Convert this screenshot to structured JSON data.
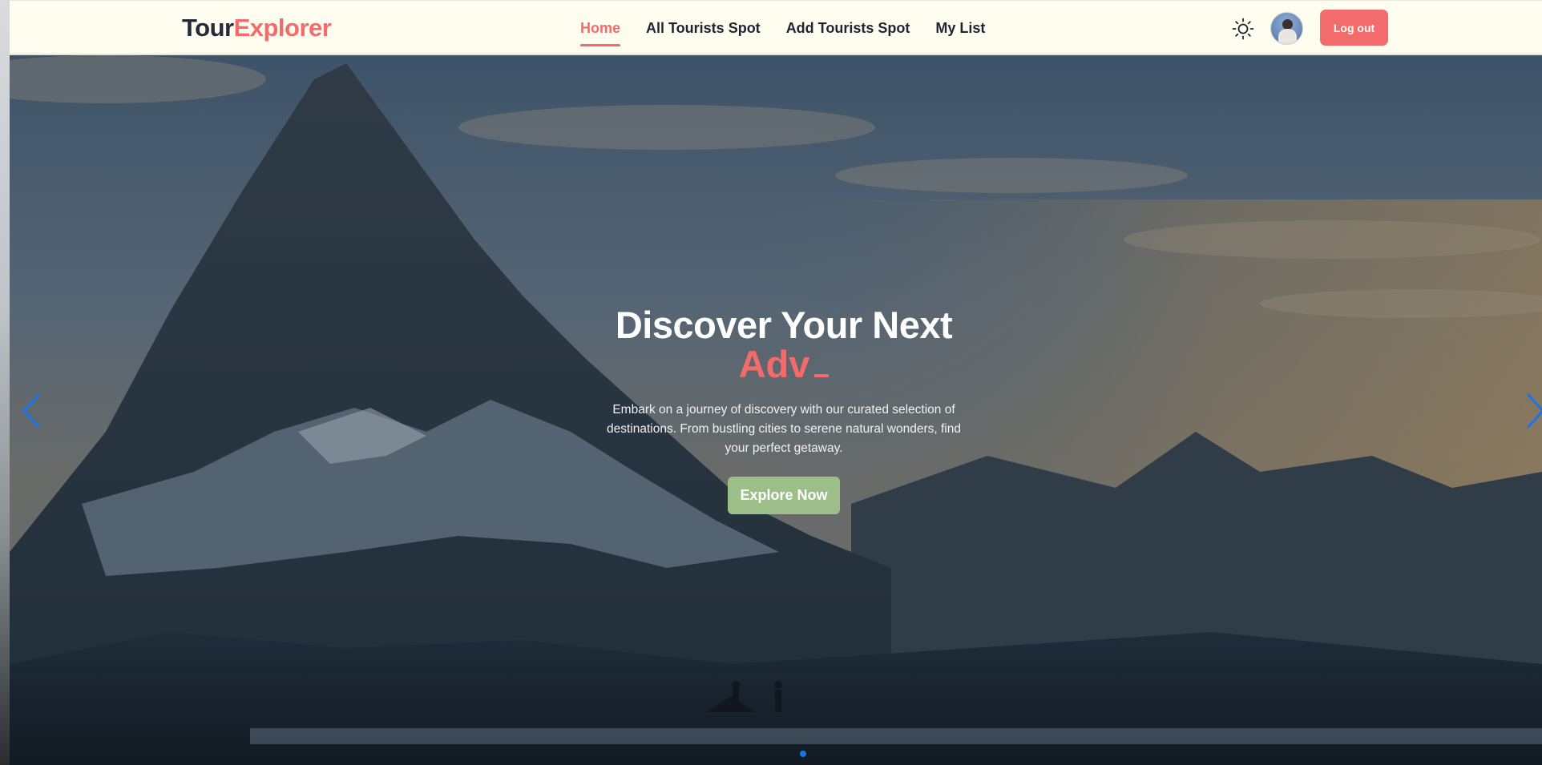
{
  "brand": {
    "part1": "Tour",
    "part2": "Explorer"
  },
  "nav": {
    "items": [
      {
        "label": "Home",
        "active": true
      },
      {
        "label": "All Tourists Spot",
        "active": false
      },
      {
        "label": "Add Tourists Spot",
        "active": false
      },
      {
        "label": "My List",
        "active": false
      }
    ],
    "theme_icon": "sun-icon",
    "logout_label": "Log out"
  },
  "hero": {
    "title": "Discover Your Next",
    "typed_text": "Adv",
    "description": "Embark on a journey of discovery with our curated selection of destinations. From bustling cities to serene natural wonders, find your perfect getaway.",
    "cta_label": "Explore Now",
    "slide_count": 1,
    "active_slide": 1
  },
  "colors": {
    "accent": "#f36b6b",
    "cta": "#9cbf8a",
    "navbar_bg": "#fefdf0",
    "active_dot": "#1a73e8"
  }
}
